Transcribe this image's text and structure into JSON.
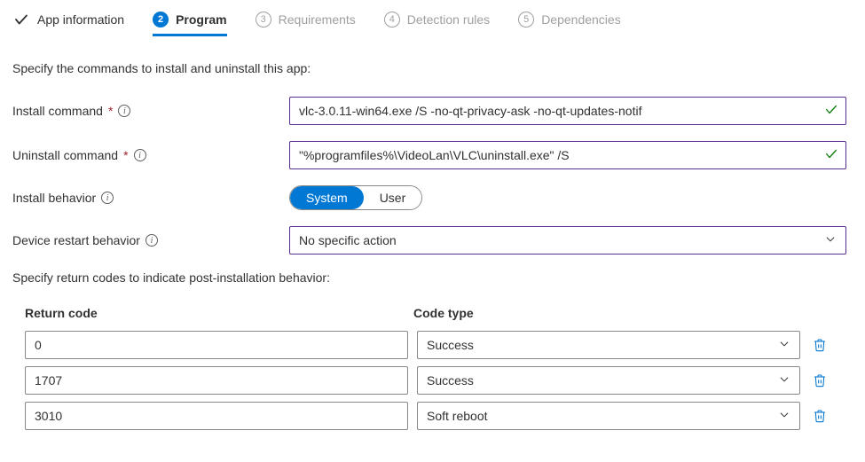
{
  "tabs": [
    {
      "label": "App information",
      "state": "done"
    },
    {
      "num": "2",
      "label": "Program",
      "state": "active"
    },
    {
      "num": "3",
      "label": "Requirements",
      "state": "future"
    },
    {
      "num": "4",
      "label": "Detection rules",
      "state": "future"
    },
    {
      "num": "5",
      "label": "Dependencies",
      "state": "future"
    }
  ],
  "desc1": "Specify the commands to install and uninstall this app:",
  "fields": {
    "install_command": {
      "label": "Install command",
      "value": "vlc-3.0.11-win64.exe /S -no-qt-privacy-ask -no-qt-updates-notif"
    },
    "uninstall_command": {
      "label": "Uninstall command",
      "value": "\"%programfiles%\\VideoLan\\VLC\\uninstall.exe\" /S"
    },
    "install_behavior": {
      "label": "Install behavior",
      "options": {
        "system": "System",
        "user": "User"
      },
      "selected": "system"
    },
    "restart_behavior": {
      "label": "Device restart behavior",
      "value": "No specific action"
    }
  },
  "desc2": "Specify return codes to indicate post-installation behavior:",
  "return_codes": {
    "header_code": "Return code",
    "header_type": "Code type",
    "rows": [
      {
        "code": "0",
        "type": "Success"
      },
      {
        "code": "1707",
        "type": "Success"
      },
      {
        "code": "3010",
        "type": "Soft reboot"
      }
    ]
  }
}
